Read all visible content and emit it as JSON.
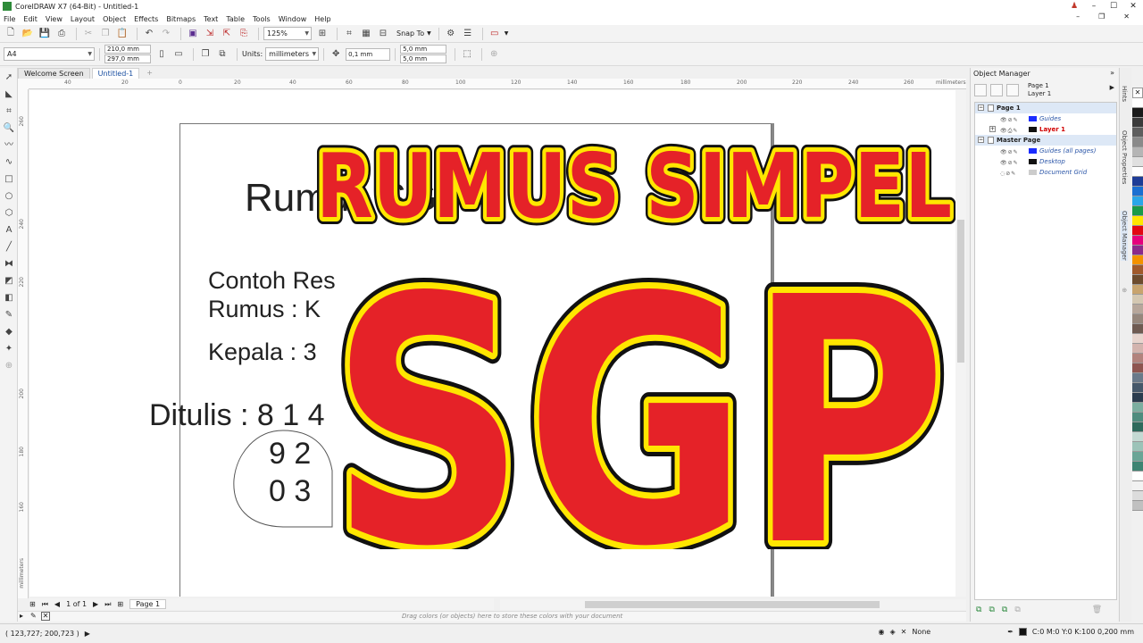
{
  "window": {
    "title": "CorelDRAW X7 (64-Bit) - Untitled-1",
    "controls": [
      "–",
      "☐",
      "✕"
    ],
    "user_icon": "user-icon"
  },
  "menu": {
    "items": [
      "File",
      "Edit",
      "View",
      "Layout",
      "Object",
      "Effects",
      "Bitmaps",
      "Text",
      "Table",
      "Tools",
      "Window",
      "Help"
    ],
    "mdi_controls": [
      "–",
      "❐",
      "✕"
    ]
  },
  "toolbar1": {
    "zoom": "125%",
    "snap_to": "Snap To"
  },
  "toolbar2": {
    "page_size": "A4",
    "width": "210,0 mm",
    "height": "297,0 mm",
    "units_label": "Units:",
    "units": "millimeters",
    "nudge": "0,1 mm",
    "dup_x": "5,0 mm",
    "dup_y": "5,0 mm"
  },
  "doc_tabs": [
    "Welcome Screen",
    "Untitled-1"
  ],
  "ruler": {
    "top_ticks": [
      "40",
      "20",
      "0",
      "20",
      "40",
      "60",
      "80",
      "100",
      "120",
      "140",
      "160",
      "180",
      "200",
      "220",
      "240",
      "260"
    ],
    "top_unit": "millimeters",
    "left_ticks": [
      "260",
      "240",
      "220",
      "200",
      "180",
      "160"
    ],
    "left_unit": "millimeters"
  },
  "page_content": {
    "title": "Rumus SGP",
    "line1": "Contoh Res",
    "line2": "Rumus : K",
    "line3": "Kepala : 3",
    "line4": "Ditulis : 8 1 4",
    "line5": "9 2",
    "line6": "0 3"
  },
  "overlay": {
    "top_text": "RUMUS SIMPEL",
    "big_text": "SGP",
    "fill_color": "#e52228",
    "inner_stroke": "#ffe600",
    "outer_stroke": "#111111"
  },
  "page_nav": {
    "count": "1 of 1",
    "tab": "Page 1"
  },
  "colorbar_hint": "Drag colors (or objects) here to store these colors with your document",
  "status": {
    "coords": "( 123,727; 200,723 )",
    "fill_none": "None",
    "outline": "C:0 M:0 Y:0 K:100  0,200 mm"
  },
  "object_manager": {
    "title": "Object Manager",
    "current_page": "Page 1",
    "current_layer": "Layer 1",
    "tree": [
      {
        "type": "page",
        "label": "Page 1"
      },
      {
        "type": "layer",
        "label": "Guides",
        "swatch": "#1a2cff",
        "style": "italic"
      },
      {
        "type": "layer",
        "label": "Layer 1",
        "swatch": "#111111",
        "style": "red"
      },
      {
        "type": "page",
        "label": "Master Page"
      },
      {
        "type": "layer",
        "label": "Guides (all pages)",
        "swatch": "#1a2cff",
        "style": "italic"
      },
      {
        "type": "layer",
        "label": "Desktop",
        "swatch": "#111111",
        "style": "italic"
      },
      {
        "type": "layer",
        "label": "Document Grid",
        "swatch": "#cccccc",
        "style": "italic"
      }
    ]
  },
  "side_tabs": [
    "Hints",
    "Object Properties",
    "Object Manager"
  ],
  "palette": [
    "#ffffff",
    "#1a1a1a",
    "#3b3b3b",
    "#5e5e5e",
    "#8a8a8a",
    "#b5b5b5",
    "#e0e0e0",
    "#ffffff",
    "#1e3c96",
    "#1b6fd1",
    "#2aa6e8",
    "#1a9a49",
    "#ffe600",
    "#e30613",
    "#e5007d",
    "#8b2a8b",
    "#f39200",
    "#a05a2c",
    "#6d4c2e",
    "#c8a46e",
    "#d4c8b2",
    "#b7a79b",
    "#96877c",
    "#6f5b52",
    "#e8d5ce",
    "#d3b4ae",
    "#b2837d",
    "#8e5550",
    "#6a7a8a",
    "#46586a",
    "#2b3c4e",
    "#7caea0",
    "#4f8c7e",
    "#2e6a5c",
    "#c4d9d3",
    "#9cc3b8",
    "#6aa596",
    "#3e8472",
    "#ffffff",
    "#f2f2f2",
    "#dcdcdc",
    "#c0c0c0"
  ]
}
